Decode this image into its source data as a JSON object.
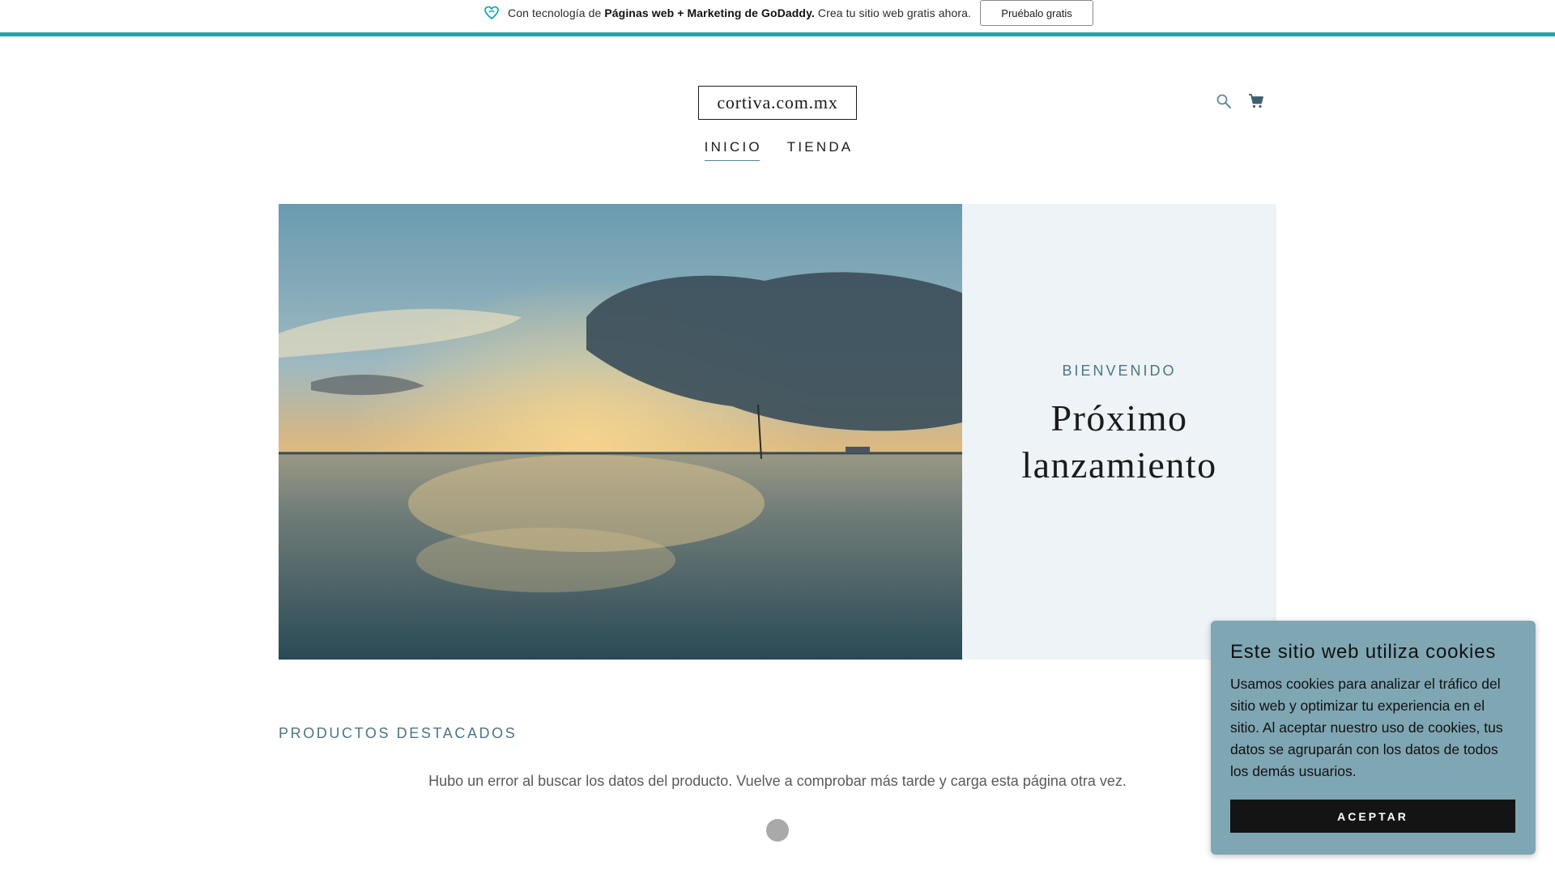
{
  "promo": {
    "prefix": "Con tecnología de ",
    "brand": "Páginas web + Marketing de GoDaddy.",
    "suffix": " Crea tu sitio web gratis ahora.",
    "button_label": "Pruébalo gratis",
    "accent_color": "#1aa8a8"
  },
  "header": {
    "logo_text": "cortiva.com.mx",
    "icons": [
      "search-icon",
      "cart-icon"
    ],
    "nav": [
      {
        "label": "INICIO",
        "active": true
      },
      {
        "label": "TIENDA",
        "active": false
      }
    ]
  },
  "hero": {
    "eyebrow": "BIENVENIDO",
    "title": "Próximo lanzamiento"
  },
  "products": {
    "section_title": "PRODUCTOS DESTACADOS",
    "error_message": "Hubo un error al buscar los datos del producto. Vuelve a comprobar más tarde y carga esta página otra vez."
  },
  "cookie_banner": {
    "title": "Este sitio web utiliza cookies",
    "body": "Usamos cookies para analizar el tráfico del sitio web y optimizar tu experiencia en el sitio. Al aceptar nuestro uso de cookies, tus datos se agruparán con los datos de todos los demás usuarios.",
    "accept_label": "ACEPTAR",
    "background_color": "#7fa6b3"
  }
}
